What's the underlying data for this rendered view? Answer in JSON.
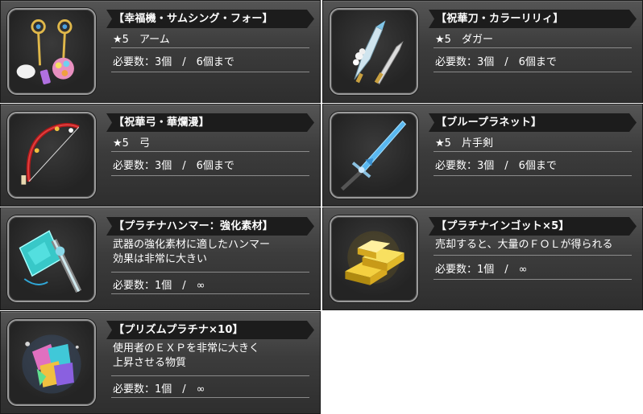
{
  "items": [
    {
      "title": "【幸福機・サムシング・フォー】",
      "rarity": "★5",
      "type": "アーム",
      "req": "必要数：3個　/　6個まで"
    },
    {
      "title": "【祝華刀・カラーリリィ】",
      "rarity": "★5",
      "type": "ダガー",
      "req": "必要数：3個　/　6個まで"
    },
    {
      "title": "【祝華弓・華爛漫】",
      "rarity": "★5",
      "type": "弓",
      "req": "必要数：3個　/　6個まで"
    },
    {
      "title": "【ブループラネット】",
      "rarity": "★5",
      "type": "片手剣",
      "req": "必要数：3個　/　6個まで"
    },
    {
      "title": "【プラチナハンマー：強化素材】",
      "desc1": "武器の強化素材に適したハンマー",
      "desc2": "効果は非常に大きい",
      "req": "必要数：1個　/　∞"
    },
    {
      "title": "【プラチナインゴット×5】",
      "desc1": "売却すると、大量のＦＯＬが得られる",
      "req": "必要数：1個　/　∞"
    },
    {
      "title": "【プリズムプラチナ×10】",
      "desc1": "使用者のＥＸＰを非常に大きく",
      "desc2": "上昇させる物質",
      "req": "必要数：1個　/　∞"
    }
  ]
}
